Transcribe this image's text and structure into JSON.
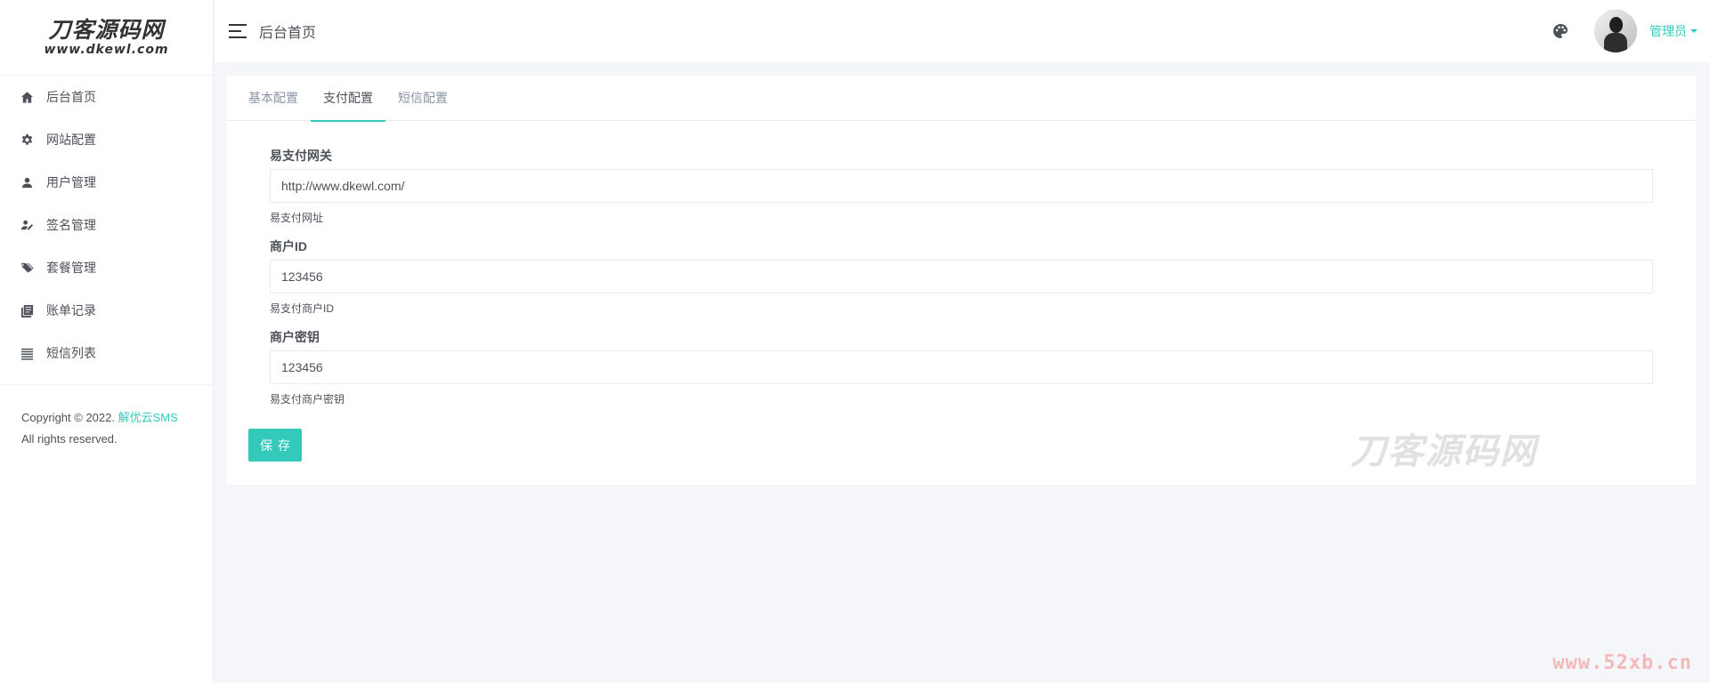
{
  "logo": {
    "main": "刀客源码网",
    "sub": "www.dkewl.com"
  },
  "sidebar": {
    "items": [
      {
        "label": "后台首页",
        "icon": "home-icon"
      },
      {
        "label": "网站配置",
        "icon": "gear-icon"
      },
      {
        "label": "用户管理",
        "icon": "user-icon"
      },
      {
        "label": "签名管理",
        "icon": "signature-icon"
      },
      {
        "label": "套餐管理",
        "icon": "tags-icon"
      },
      {
        "label": "账单记录",
        "icon": "book-icon"
      },
      {
        "label": "短信列表",
        "icon": "list-icon"
      }
    ],
    "copyright_prefix": "Copyright © 2022.",
    "copyright_brand": "解优云SMS",
    "copyright_suffix": "All rights reserved."
  },
  "header": {
    "title": "后台首页",
    "user_name": "管理员"
  },
  "tabs": [
    {
      "label": "基本配置",
      "active": false
    },
    {
      "label": "支付配置",
      "active": true
    },
    {
      "label": "短信配置",
      "active": false
    }
  ],
  "form": {
    "fields": [
      {
        "label": "易支付网关",
        "value": "http://www.dkewl.com/",
        "help": "易支付网址"
      },
      {
        "label": "商户ID",
        "value": "123456",
        "help": "易支付商户ID"
      },
      {
        "label": "商户密钥",
        "value": "123456",
        "help": "易支付商户密钥"
      }
    ],
    "save_label": "保存"
  },
  "watermarks": {
    "center": "刀客源码网",
    "corner": "www.52xb.cn"
  },
  "colors": {
    "accent": "#33cabb",
    "text": "#4d5259",
    "muted": "#8b95a5",
    "background": "#f5f6fa"
  }
}
